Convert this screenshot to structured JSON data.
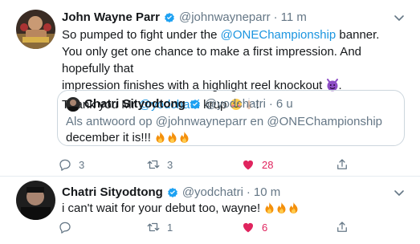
{
  "colors": {
    "link": "#1b95e0",
    "secondary": "#657786",
    "like": "#e0245e",
    "verified": "#1da1f2"
  },
  "tweet1": {
    "name": "John Wayne Parr",
    "handle": "@johnwayneparr",
    "dot": "·",
    "time": "11 m",
    "line1_pre": "So pumped to fight under the ",
    "line1_mention": "@ONEChampionship",
    "line1_post": " banner.",
    "line2": "You only get one chance to make a first impression. And hopefully that",
    "line3": "impression finishes with a highlight reel knockout ",
    "line4_pre": "Thank you Mr ",
    "line4_mention": "@yodchatri",
    "line4_post": " krup ",
    "line4_end": "!",
    "quote": {
      "name": "Chatri Sityodtong",
      "handle": "@yodchatri",
      "dot": "·",
      "time": "6 u",
      "reply_to": "Als antwoord op @johnwayneparr en @ONEChampionship",
      "text": "december it is!!! "
    },
    "actions": {
      "reply_count": "3",
      "retweet_count": "3",
      "like_count": "28"
    }
  },
  "tweet2": {
    "name": "Chatri Sityodtong",
    "handle": "@yodchatri",
    "dot": "·",
    "time": "10 m",
    "text": "i can't wait for your debut too, wayne! ",
    "actions": {
      "reply_count": "",
      "retweet_count": "1",
      "like_count": "6"
    }
  }
}
